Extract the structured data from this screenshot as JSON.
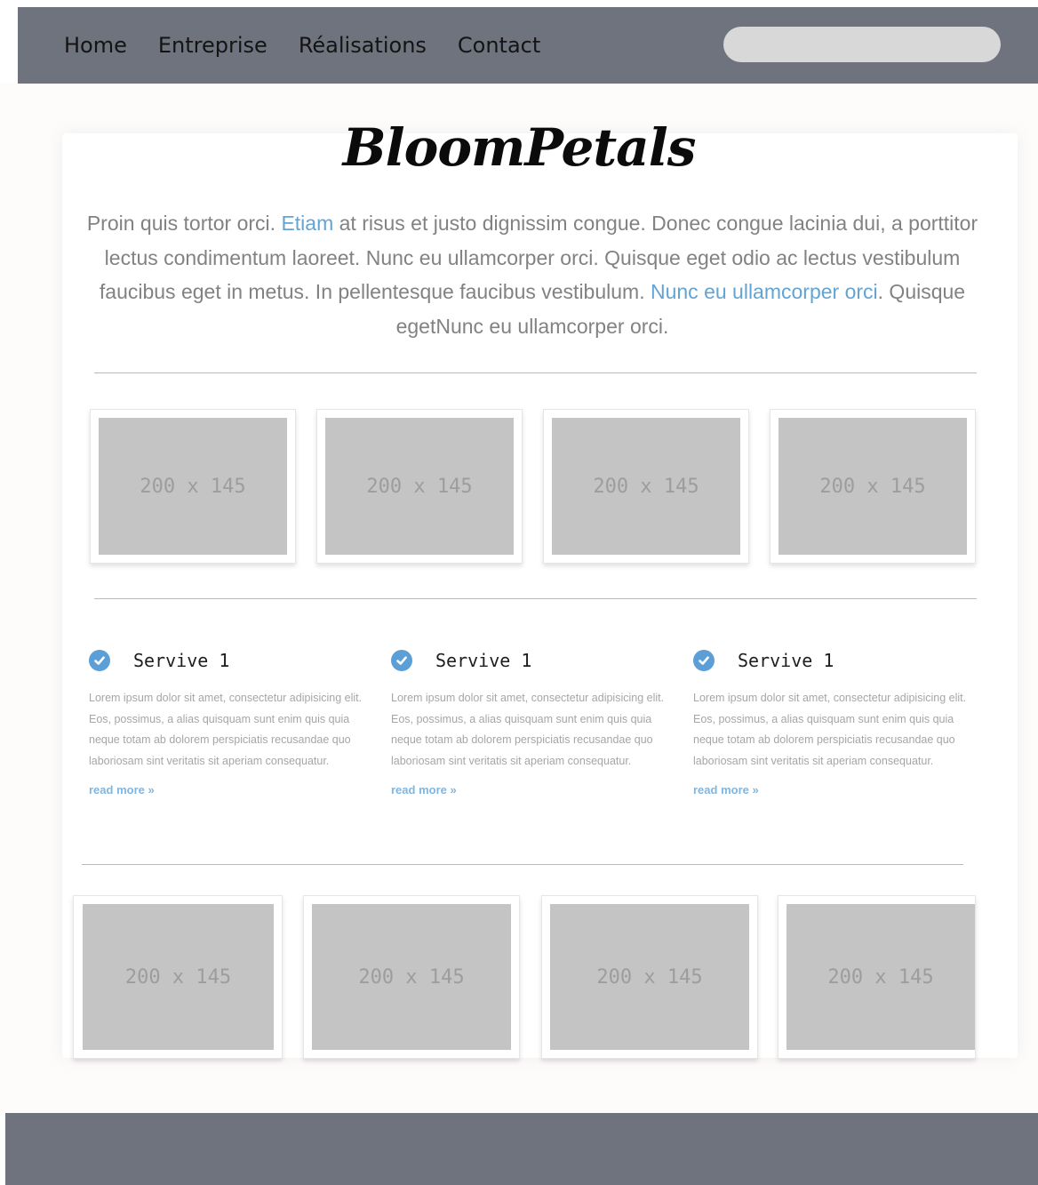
{
  "nav": {
    "items": [
      "Home",
      "Entreprise",
      "Réalisations",
      "Contact"
    ],
    "search_placeholder": ""
  },
  "logo": "BloomPetals",
  "intro": {
    "t1": "Proin quis tortor orci. ",
    "l1": "Etiam",
    "t2": " at risus et justo dignissim congue. Donec congue lacinia dui, a porttitor lectus condimentum laoreet. Nunc eu ullamcorper orci. Quisque eget odio ac lectus vestibulum faucibus eget in metus. In pellentesque faucibus vestibulum. ",
    "l2": "Nunc eu ullamcorper orci",
    "t3": ". Quisque egetNunc eu ullamcorper orci."
  },
  "gallery_top": [
    "200 x 145",
    "200 x 145",
    "200 x 145",
    "200 x 145"
  ],
  "services": [
    {
      "title": "Servive 1",
      "text": "Lorem ipsum dolor sit amet, consectetur adipisicing elit. Eos, possimus, a alias quisquam sunt enim quis quia neque totam ab dolorem perspiciatis recusandae quo laboriosam sint veritatis sit aperiam consequatur.",
      "link": "read more »"
    },
    {
      "title": "Servive 1",
      "text": "Lorem ipsum dolor sit amet, consectetur adipisicing elit. Eos, possimus, a alias quisquam sunt enim quis quia neque totam ab dolorem perspiciatis recusandae quo laboriosam sint veritatis sit aperiam consequatur.",
      "link": "read more »"
    },
    {
      "title": "Servive 1",
      "text": "Lorem ipsum dolor sit amet, consectetur adipisicing elit. Eos, possimus, a alias quisquam sunt enim quis quia neque totam ab dolorem perspiciatis recusandae quo laboriosam sint veritatis sit aperiam consequatur.",
      "link": "read more »"
    }
  ],
  "gallery_bottom": [
    "200 x 145",
    "200 x 145",
    "200 x 145",
    "200 x 145"
  ],
  "colors": {
    "navbar": "#6f737e",
    "footer": "#6f737e",
    "link": "#62a4d4",
    "check": "#5b9fd6",
    "placeholder": "#c4c4c4"
  }
}
